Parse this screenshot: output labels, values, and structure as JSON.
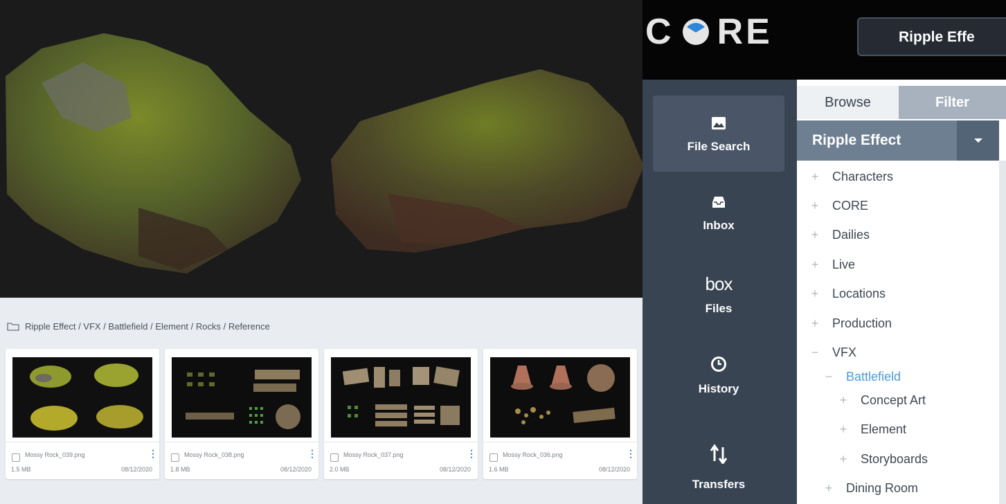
{
  "app": {
    "logo_text": "CORE",
    "project_button": "Ripple Effe"
  },
  "nav": [
    {
      "label": "File Search",
      "icon": "image-icon",
      "active": true
    },
    {
      "label": "Inbox",
      "icon": "inbox-icon",
      "active": false
    },
    {
      "label": "Files",
      "icon": "box-logo",
      "active": false,
      "logo_text": "box"
    },
    {
      "label": "History",
      "icon": "clock-icon",
      "active": false
    },
    {
      "label": "Transfers",
      "icon": "transfer-arrows-icon",
      "active": false
    }
  ],
  "panel": {
    "tabs": [
      {
        "label": "Browse"
      },
      {
        "label": "Filter"
      }
    ],
    "project_select": "Ripple Effect",
    "tree": [
      {
        "sign": "+",
        "label": "Characters",
        "indent": 0
      },
      {
        "sign": "+",
        "label": "CORE",
        "indent": 0
      },
      {
        "sign": "+",
        "label": "Dailies",
        "indent": 0
      },
      {
        "sign": "+",
        "label": "Live",
        "indent": 0
      },
      {
        "sign": "+",
        "label": "Locations",
        "indent": 0
      },
      {
        "sign": "+",
        "label": "Production",
        "indent": 0
      },
      {
        "sign": "−",
        "label": "VFX",
        "indent": 0
      },
      {
        "sign": "−",
        "label": "Battlefield",
        "indent": 1,
        "selected": true
      },
      {
        "sign": "+",
        "label": "Concept Art",
        "indent": 2
      },
      {
        "sign": "+",
        "label": "Element",
        "indent": 2
      },
      {
        "sign": "+",
        "label": "Storyboards",
        "indent": 2
      },
      {
        "sign": "+",
        "label": "Dining Room",
        "indent": 1
      }
    ]
  },
  "breadcrumb": "Ripple Effect / VFX / Battlefield / Element / Rocks / Reference",
  "files": [
    {
      "name": "Mossy Rock_039.png",
      "size": "1.5 MB",
      "date": "08/12/2020"
    },
    {
      "name": "Mossy Rock_038.png",
      "size": "1.8 MB",
      "date": "08/12/2020"
    },
    {
      "name": "Mossy Rock_037.png",
      "size": "2.0 MB",
      "date": "08/12/2020"
    },
    {
      "name": "Mossy Rock_036.png",
      "size": "1.6 MB",
      "date": "08/12/2020"
    }
  ],
  "colors": {
    "sidebar": "#394452",
    "active_nav": "#4a5668",
    "project_select": "#6f7f92",
    "selected_tree": "#4a9be0"
  }
}
